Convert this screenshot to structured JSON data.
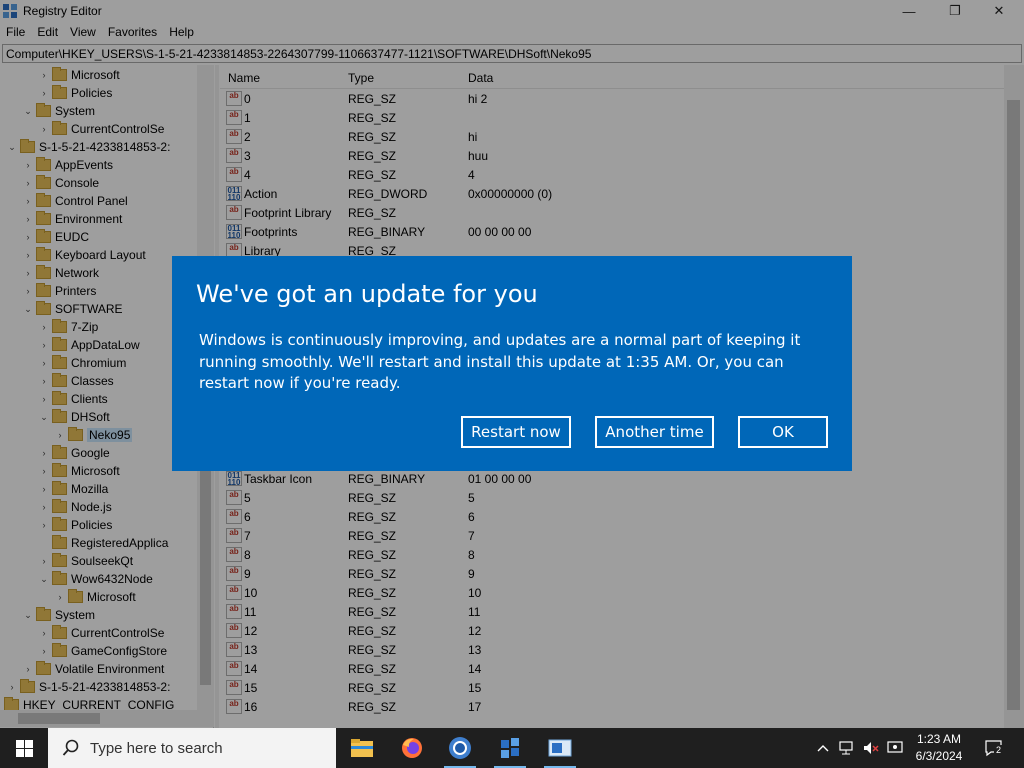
{
  "window": {
    "title": "Registry Editor",
    "minimize_glyph": "—",
    "maximize_glyph": "❐",
    "close_glyph": "✕"
  },
  "menu": [
    "File",
    "Edit",
    "View",
    "Favorites",
    "Help"
  ],
  "address": "Computer\\HKEY_USERS\\S-1-5-21-4233814853-2264307799-1106637477-1121\\SOFTWARE\\DHSoft\\Neko95",
  "tree": [
    {
      "label": "Microsoft",
      "level": 3,
      "exp": ">",
      "selected": false
    },
    {
      "label": "Policies",
      "level": 3,
      "exp": ">",
      "selected": false
    },
    {
      "label": "System",
      "level": 2,
      "exp": "v",
      "selected": false
    },
    {
      "label": "CurrentControlSe",
      "level": 3,
      "exp": ">",
      "selected": false
    },
    {
      "label": "S-1-5-21-4233814853-2:",
      "level": 1,
      "exp": "v",
      "selected": false
    },
    {
      "label": "AppEvents",
      "level": 2,
      "exp": ">",
      "selected": false
    },
    {
      "label": "Console",
      "level": 2,
      "exp": ">",
      "selected": false
    },
    {
      "label": "Control Panel",
      "level": 2,
      "exp": ">",
      "selected": false
    },
    {
      "label": "Environment",
      "level": 2,
      "exp": ">",
      "selected": false
    },
    {
      "label": "EUDC",
      "level": 2,
      "exp": ">",
      "selected": false
    },
    {
      "label": "Keyboard Layout",
      "level": 2,
      "exp": ">",
      "selected": false
    },
    {
      "label": "Network",
      "level": 2,
      "exp": ">",
      "selected": false
    },
    {
      "label": "Printers",
      "level": 2,
      "exp": ">",
      "selected": false
    },
    {
      "label": "SOFTWARE",
      "level": 2,
      "exp": "v",
      "selected": false
    },
    {
      "label": "7-Zip",
      "level": 3,
      "exp": ">",
      "selected": false
    },
    {
      "label": "AppDataLow",
      "level": 3,
      "exp": ">",
      "selected": false
    },
    {
      "label": "Chromium",
      "level": 3,
      "exp": ">",
      "selected": false
    },
    {
      "label": "Classes",
      "level": 3,
      "exp": ">",
      "selected": false
    },
    {
      "label": "Clients",
      "level": 3,
      "exp": ">",
      "selected": false
    },
    {
      "label": "DHSoft",
      "level": 3,
      "exp": "v",
      "selected": false
    },
    {
      "label": "Neko95",
      "level": 4,
      "exp": ">",
      "selected": true
    },
    {
      "label": "Google",
      "level": 3,
      "exp": ">",
      "selected": false
    },
    {
      "label": "Microsoft",
      "level": 3,
      "exp": ">",
      "selected": false
    },
    {
      "label": "Mozilla",
      "level": 3,
      "exp": ">",
      "selected": false
    },
    {
      "label": "Node.js",
      "level": 3,
      "exp": ">",
      "selected": false
    },
    {
      "label": "Policies",
      "level": 3,
      "exp": ">",
      "selected": false
    },
    {
      "label": "RegisteredApplica",
      "level": 3,
      "exp": "",
      "selected": false
    },
    {
      "label": "SoulseekQt",
      "level": 3,
      "exp": ">",
      "selected": false
    },
    {
      "label": "Wow6432Node",
      "level": 3,
      "exp": "v",
      "selected": false
    },
    {
      "label": "Microsoft",
      "level": 4,
      "exp": ">",
      "selected": false
    },
    {
      "label": "System",
      "level": 2,
      "exp": "v",
      "selected": false
    },
    {
      "label": "CurrentControlSe",
      "level": 3,
      "exp": ">",
      "selected": false
    },
    {
      "label": "GameConfigStore",
      "level": 3,
      "exp": ">",
      "selected": false
    },
    {
      "label": "Volatile Environment",
      "level": 2,
      "exp": ">",
      "selected": false
    },
    {
      "label": "S-1-5-21-4233814853-2:",
      "level": 1,
      "exp": ">",
      "selected": false
    },
    {
      "label": "HKEY_CURRENT_CONFIG",
      "level": 0,
      "exp": ">",
      "selected": false
    }
  ],
  "columns": {
    "name": "Name",
    "type": "Type",
    "data": "Data"
  },
  "values_top": [
    {
      "name": "0",
      "type": "REG_SZ",
      "data": "hi 2",
      "icon": "string-value-icon"
    },
    {
      "name": "1",
      "type": "REG_SZ",
      "data": "",
      "icon": "string-value-icon"
    },
    {
      "name": "2",
      "type": "REG_SZ",
      "data": "hi",
      "icon": "string-value-icon"
    },
    {
      "name": "3",
      "type": "REG_SZ",
      "data": "huu",
      "icon": "string-value-icon"
    },
    {
      "name": "4",
      "type": "REG_SZ",
      "data": "4",
      "icon": "string-value-icon"
    },
    {
      "name": "Action",
      "type": "REG_DWORD",
      "data": "0x00000000 (0)",
      "icon": "binary-value-icon"
    },
    {
      "name": "Footprint Library",
      "type": "REG_SZ",
      "data": "",
      "icon": "string-value-icon"
    },
    {
      "name": "Footprints",
      "type": "REG_BINARY",
      "data": "00 00 00 00",
      "icon": "binary-value-icon"
    },
    {
      "name": "Library",
      "type": "REG_SZ",
      "data": "",
      "icon": "string-value-icon"
    }
  ],
  "values_bottom": [
    {
      "name": "Taskbar Icon",
      "type": "REG_BINARY",
      "data": "01 00 00 00",
      "icon": "binary-value-icon"
    },
    {
      "name": "5",
      "type": "REG_SZ",
      "data": "5",
      "icon": "string-value-icon"
    },
    {
      "name": "6",
      "type": "REG_SZ",
      "data": "6",
      "icon": "string-value-icon"
    },
    {
      "name": "7",
      "type": "REG_SZ",
      "data": "7",
      "icon": "string-value-icon"
    },
    {
      "name": "8",
      "type": "REG_SZ",
      "data": "8",
      "icon": "string-value-icon"
    },
    {
      "name": "9",
      "type": "REG_SZ",
      "data": "9",
      "icon": "string-value-icon"
    },
    {
      "name": "10",
      "type": "REG_SZ",
      "data": "10",
      "icon": "string-value-icon"
    },
    {
      "name": "11",
      "type": "REG_SZ",
      "data": "11",
      "icon": "string-value-icon"
    },
    {
      "name": "12",
      "type": "REG_SZ",
      "data": "12",
      "icon": "string-value-icon"
    },
    {
      "name": "13",
      "type": "REG_SZ",
      "data": "13",
      "icon": "string-value-icon"
    },
    {
      "name": "14",
      "type": "REG_SZ",
      "data": "14",
      "icon": "string-value-icon"
    },
    {
      "name": "15",
      "type": "REG_SZ",
      "data": "15",
      "icon": "string-value-icon"
    },
    {
      "name": "16",
      "type": "REG_SZ",
      "data": "17",
      "icon": "string-value-icon"
    }
  ],
  "dialog": {
    "title": "We've got an update for you",
    "body": "Windows is continuously improving, and updates are a normal part of keeping it running smoothly. We'll restart and install this update at 1:35 AM. Or, you can restart now if you're ready.",
    "restart_label": "Restart now",
    "another_time_label": "Another time",
    "ok_label": "OK",
    "bg_color": "#0067b8"
  },
  "taskbar": {
    "search_placeholder": "Type here to search",
    "time": "1:23 AM",
    "date": "6/3/2024",
    "notification_count": "2",
    "apps": [
      "file-explorer-icon",
      "firefox-icon",
      "chromium-icon",
      "registry-editor-icon",
      "window-app-icon"
    ]
  }
}
